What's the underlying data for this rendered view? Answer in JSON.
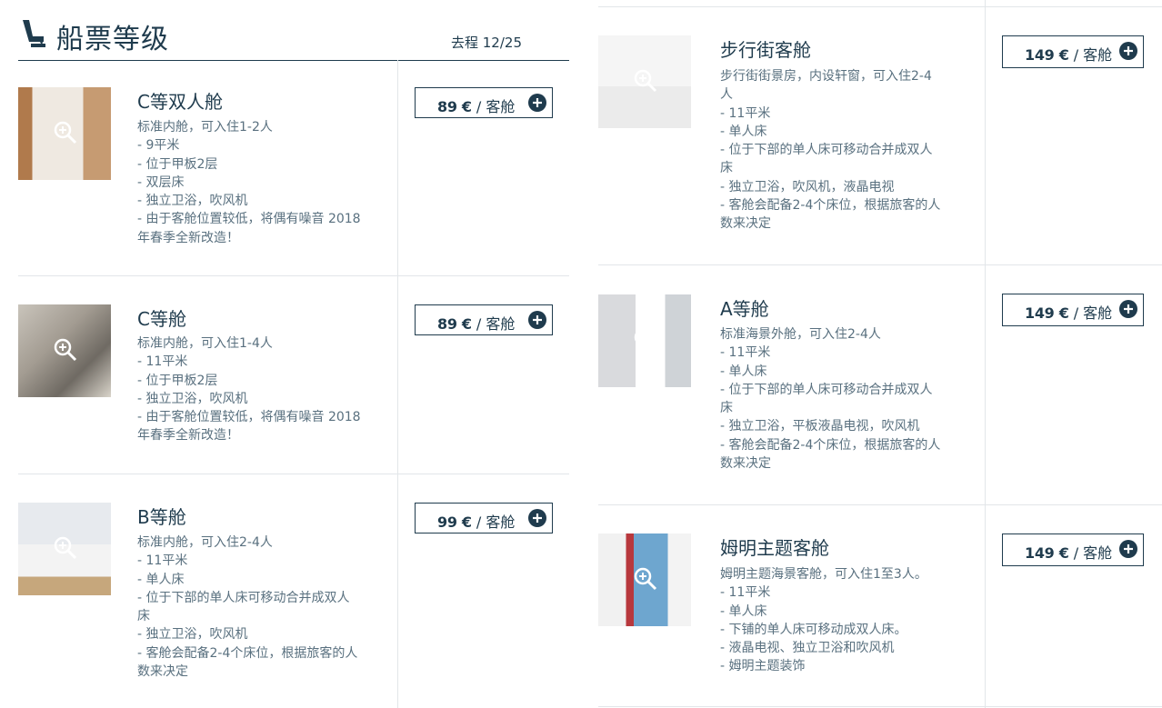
{
  "header": {
    "title": "船票等级",
    "trip": "去程 12/25"
  },
  "price_unit": "/ 客舱",
  "cabins_left": [
    {
      "name": "C等双人舱",
      "price": "89 €",
      "desc": [
        "标准内舱，可入住1-2人",
        "- 9平米",
        "- 位于甲板2层",
        "- 双层床",
        "- 独立卫浴，吹风机",
        "- 由于客舱位置较低，将偶有噪音 2018",
        "年春季全新改造！"
      ]
    },
    {
      "name": "C等舱",
      "price": "89 €",
      "desc": [
        "标准内舱，可入住1-4人",
        "- 11平米",
        "- 位于甲板2层",
        "- 独立卫浴，吹风机",
        "- 由于客舱位置较低，将偶有噪音 2018",
        "年春季全新改造！"
      ]
    },
    {
      "name": "B等舱",
      "price": "99 €",
      "desc": [
        "标准内舱，可入住2-4人",
        "- 11平米",
        "- 单人床",
        "- 位于下部的单人床可移动合并成双人",
        "床",
        "- 独立卫浴，吹风机",
        "- 客舱会配备2-4个床位，根据旅客的人",
        "数来决定"
      ]
    }
  ],
  "cabins_right": [
    {
      "name": "步行街客舱",
      "price": "149 €",
      "desc": [
        "步行街街景房，内设轩窗，可入住2-4",
        "人",
        "- 11平米",
        "- 单人床",
        "- 位于下部的单人床可移动合并成双人",
        "床",
        "- 独立卫浴，吹风机，液晶电视",
        "- 客舱会配备2-4个床位，根据旅客的人",
        "数来决定"
      ]
    },
    {
      "name": "A等舱",
      "price": "149 €",
      "desc": [
        "标准海景外舱，可入住2-4人",
        "- 11平米",
        "- 单人床",
        "- 位于下部的单人床可移动合并成双人",
        "床",
        "- 独立卫浴，平板液晶电视，吹风机",
        "- 客舱会配备2-4个床位，根据旅客的人",
        "数来决定"
      ]
    },
    {
      "name": "姆明主题客舱",
      "price": "149 €",
      "desc": [
        "姆明主题海景客舱，可入住1至3人。",
        "- 11平米",
        "- 单人床",
        "- 下铺的单人床可移动成双人床。",
        "- 液晶电视、独立卫浴和吹风机",
        "- 姆明主题装饰"
      ]
    }
  ],
  "icons": {
    "header": "seat-icon",
    "thumb": "zoom-in-icon",
    "add": "plus-circle-icon"
  },
  "colors": {
    "primary": "#1f3b4d",
    "text_muted": "#59707f",
    "divider": "#e2e6e9"
  }
}
